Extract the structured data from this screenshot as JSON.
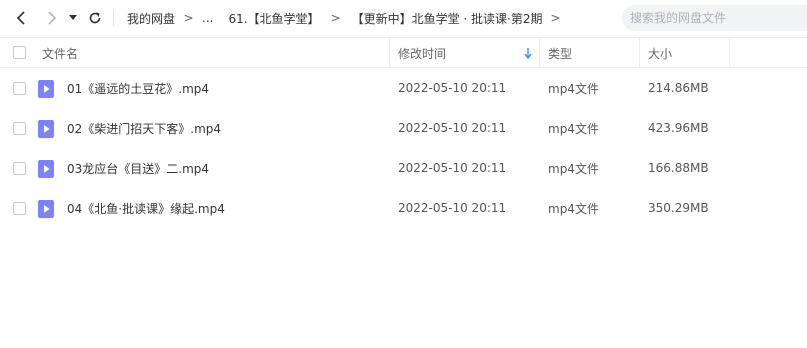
{
  "toolbar": {
    "breadcrumbs": [
      {
        "label": "我的网盘"
      },
      {
        "label": "..."
      },
      {
        "label": "61.【北鱼学堂】"
      },
      {
        "label": "【更新中】北鱼学堂 · 批读课·第2期"
      }
    ],
    "crumb_separator": ">",
    "search_placeholder": "搜索我的网盘文件"
  },
  "columns": {
    "name": "文件名",
    "modified": "修改时间",
    "type": "类型",
    "size": "大小"
  },
  "sort": {
    "column": "modified",
    "direction": "descending"
  },
  "files": [
    {
      "name": "01《遥远的土豆花》.mp4",
      "modified": "2022-05-10 20:11",
      "type": "mp4文件",
      "size": "214.86MB"
    },
    {
      "name": "02《柴进门招天下客》.mp4",
      "modified": "2022-05-10 20:11",
      "type": "mp4文件",
      "size": "423.96MB"
    },
    {
      "name": "03龙应台《目送》二.mp4",
      "modified": "2022-05-10 20:11",
      "type": "mp4文件",
      "size": "166.88MB"
    },
    {
      "name": "04《北鱼·批读课》缘起.mp4",
      "modified": "2022-05-10 20:11",
      "type": "mp4文件",
      "size": "350.29MB"
    }
  ],
  "colors": {
    "file_icon": "#7b83f6",
    "sort_arrow": "#3b8cff"
  }
}
